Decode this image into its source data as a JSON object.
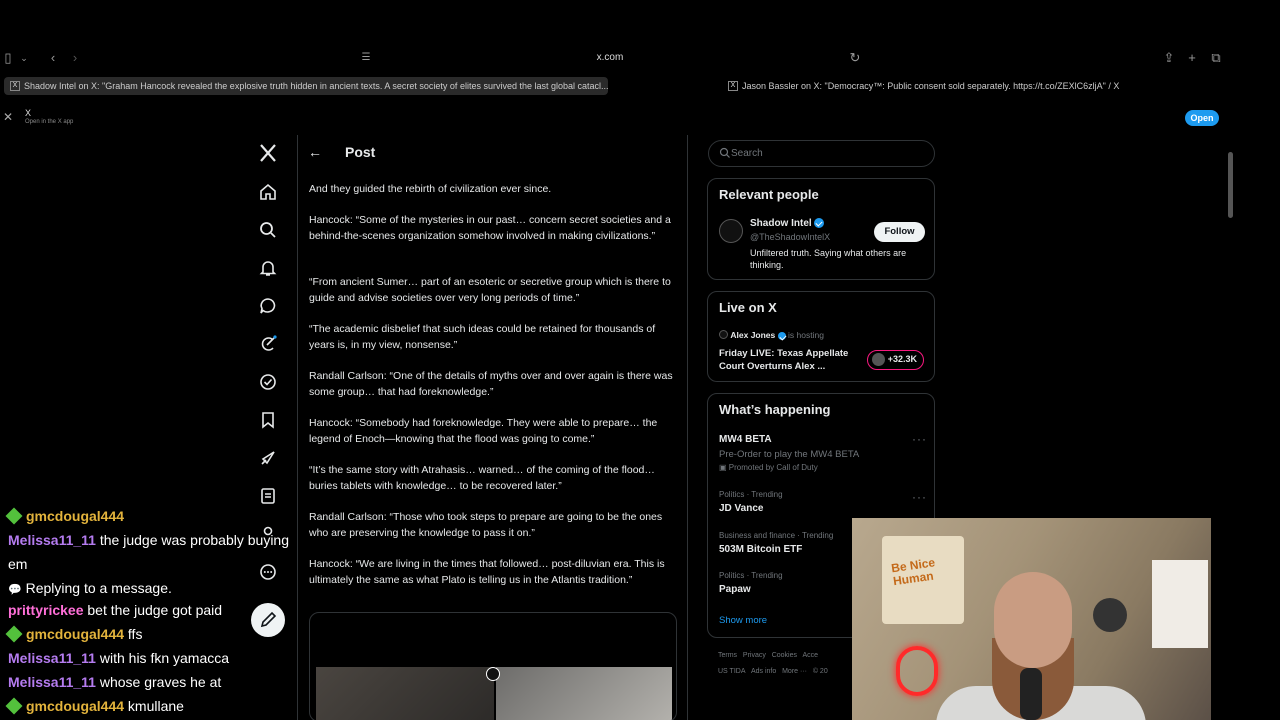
{
  "browser": {
    "url": "x.com",
    "tabs": [
      {
        "title": "Shadow Intel on X: \"Graham Hancock revealed the explosive truth hidden in ancient texts. A secret society of elites survived the last global catacl..."
      },
      {
        "title": "Jason Bassler on X: \"Democracy™: Public consent sold separately. https://t.co/ZEXlC6zljA\" / X"
      }
    ]
  },
  "app_banner": {
    "name": "X",
    "subtitle": "Open in the X app",
    "open_label": "Open"
  },
  "post": {
    "header": "Post",
    "paragraphs": [
      "And they guided the rebirth of civilization ever since.",
      "Hancock: “Some of the mysteries in our past… concern secret societies and a behind-the-scenes organization somehow involved in making civilizations.”",
      "“From ancient Sumer… part of an esoteric or secretive group which is there to guide and advise societies over very long periods of time.”",
      "“The academic disbelief that such ideas could be retained for thousands of years is, in my view, nonsense.”",
      "Randall Carlson: “One of the details of myths over and over again is there was some group… that had foreknowledge.”",
      "Hancock: “Somebody had foreknowledge. They were able to prepare… the legend of Enoch—knowing that the flood was going to come.”",
      "“It’s the same story with Atrahasis… warned… of the coming of the flood… buries tablets with knowledge… to be recovered later.”",
      "Randall Carlson: “Those who took steps to prepare are going to be the ones who are preserving the knowledge to pass it on.”",
      "Hancock: “We are living in the times that followed… post-diluvian era. This is ultimately the same as what Plato is telling us in the Atlantis tradition.”"
    ]
  },
  "search": {
    "placeholder": "Search"
  },
  "relevant_people": {
    "title": "Relevant people",
    "name": "Shadow Intel",
    "handle": "@TheShadowIntelX",
    "follow_label": "Follow",
    "bio": "Unfiltered truth. Saying what others are thinking."
  },
  "live": {
    "title": "Live on X",
    "host": "Alex Jones",
    "hosting_label": "is hosting",
    "stream_title": "Friday LIVE: Texas Appellate Court Overturns Alex ...",
    "count": "+32.3K"
  },
  "happening": {
    "title": "What’s happening",
    "items": [
      {
        "name": "MW4 BETA",
        "line1": "Pre-Order to play the MW4 BETA",
        "line2": "Promoted by Call of Duty"
      },
      {
        "context": "Politics · Trending",
        "name": "JD Vance"
      },
      {
        "context": "Business and finance · Trending",
        "name": "503M Bitcoin ETF"
      },
      {
        "context": "Politics · Trending",
        "name": "Papaw"
      }
    ],
    "show_more": "Show more"
  },
  "footer": {
    "row1": [
      "Terms",
      "Privacy",
      "Cookies",
      "Acce"
    ],
    "row2": [
      "US TIDA",
      "Ads info",
      "More ···",
      "© 20"
    ]
  },
  "chat": [
    {
      "user": "gmcdougal444",
      "message": ""
    },
    {
      "user": "Melissa11_11",
      "message": "the judge was probably buying"
    },
    {
      "user": "",
      "message": "em"
    },
    {
      "user": "",
      "message": "Replying to a message."
    },
    {
      "user": "prittyrickee",
      "message": "bet the judge got paid"
    },
    {
      "user": "gmcdougal444",
      "message": "ffs"
    },
    {
      "user": "Melissa11_11",
      "message": "with his fkn yamacca"
    },
    {
      "user": "Melissa11_11",
      "message": "whose graves he at"
    },
    {
      "user": "gmcdougal444",
      "message": "kmullane"
    }
  ],
  "webcam": {
    "poster_text": "Be Nice Human"
  }
}
